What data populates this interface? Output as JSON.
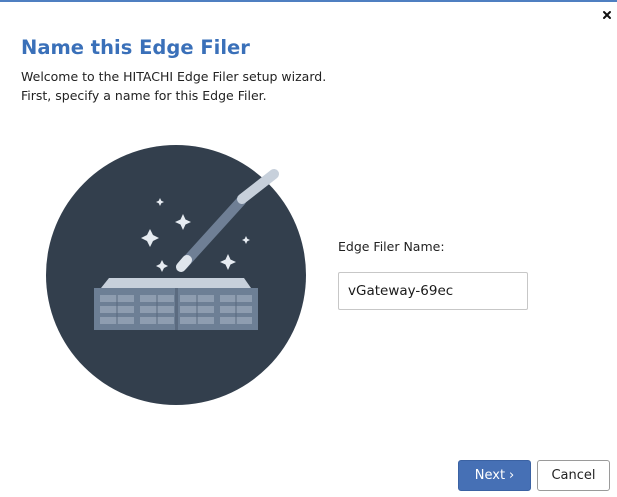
{
  "dialog": {
    "title": "Name this Edge Filer",
    "subtitle_line1": "Welcome to the HITACHI Edge Filer setup wizard.",
    "subtitle_line2": "First, specify a name for this Edge Filer.",
    "close_icon": "close-icon"
  },
  "illustration": {
    "icon": "magic-wand-over-server-icon",
    "circle_color": "#333f4d"
  },
  "form": {
    "name_label": "Edge Filer Name:",
    "name_value": "vGateway-69ec"
  },
  "buttons": {
    "next_label": "Next",
    "next_chevron": "›",
    "cancel_label": "Cancel"
  },
  "colors": {
    "accent": "#3a70b9",
    "primary_button": "#4670b5"
  }
}
